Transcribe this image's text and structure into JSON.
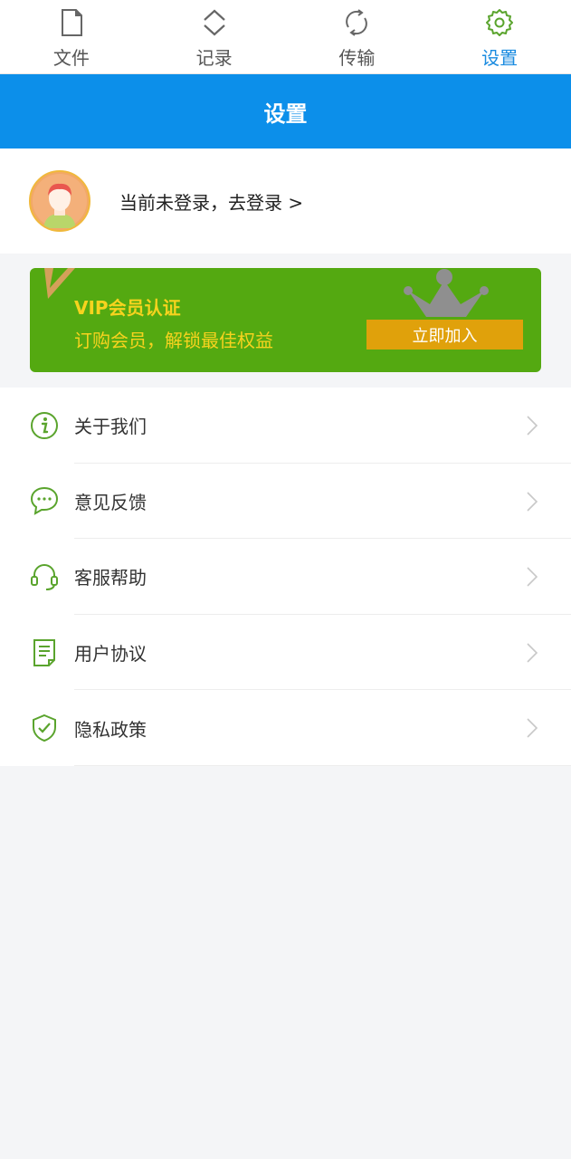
{
  "tabs": [
    {
      "label": "文件",
      "icon": "file-icon"
    },
    {
      "label": "记录",
      "icon": "record-icon"
    },
    {
      "label": "传输",
      "icon": "sync-icon"
    },
    {
      "label": "设置",
      "icon": "gear-icon",
      "active": true
    }
  ],
  "header": {
    "title": "设置"
  },
  "login": {
    "text": "当前未登录，去登录 >"
  },
  "vip": {
    "title": "VIP会员认证",
    "subtitle": "订购会员，解锁最佳权益",
    "button": "立即加入"
  },
  "menu": [
    {
      "label": "关于我们",
      "icon": "info-icon"
    },
    {
      "label": "意见反馈",
      "icon": "chat-icon"
    },
    {
      "label": "客服帮助",
      "icon": "headset-icon"
    },
    {
      "label": "用户协议",
      "icon": "document-icon"
    },
    {
      "label": "隐私政策",
      "icon": "shield-check-icon"
    }
  ],
  "colors": {
    "accent": "#1a8be0",
    "header_bg": "#0c8fea",
    "vip_bg": "#54a911",
    "vip_text": "#f7d31e",
    "vip_button": "#e0a10b",
    "icon_green": "#5aa42d"
  }
}
